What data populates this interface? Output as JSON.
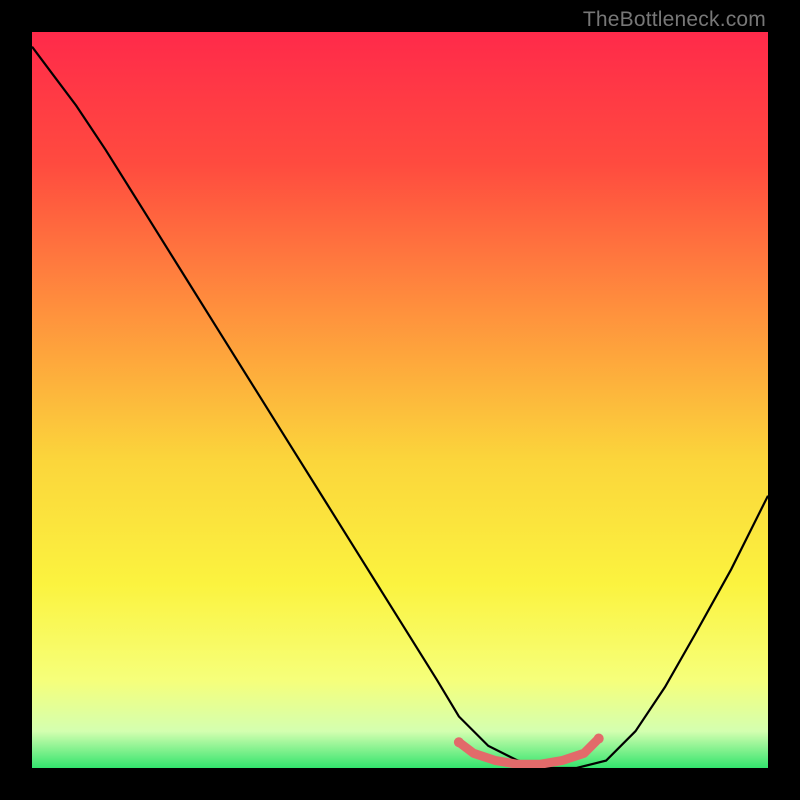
{
  "watermark": "TheBottleneck.com",
  "chart_data": {
    "type": "line",
    "title": "",
    "xlabel": "",
    "ylabel": "",
    "xlim": [
      0,
      1
    ],
    "ylim": [
      0,
      1
    ],
    "background_gradient": {
      "top": "#ff2a4a",
      "mid_upper": "#ff913d",
      "mid": "#fbe23b",
      "lower": "#f9ff8a",
      "bottom": "#33e46d"
    },
    "series": [
      {
        "name": "curve",
        "color": "#000000",
        "x": [
          0.0,
          0.03,
          0.06,
          0.1,
          0.15,
          0.2,
          0.25,
          0.3,
          0.35,
          0.4,
          0.45,
          0.5,
          0.55,
          0.58,
          0.62,
          0.66,
          0.7,
          0.74,
          0.78,
          0.82,
          0.86,
          0.9,
          0.95,
          1.0
        ],
        "y": [
          0.98,
          0.94,
          0.9,
          0.84,
          0.76,
          0.68,
          0.6,
          0.52,
          0.44,
          0.36,
          0.28,
          0.2,
          0.12,
          0.07,
          0.03,
          0.01,
          0.0,
          0.0,
          0.01,
          0.05,
          0.11,
          0.18,
          0.27,
          0.37
        ]
      },
      {
        "name": "highlight",
        "color": "#e26a6a",
        "x": [
          0.58,
          0.6,
          0.63,
          0.66,
          0.69,
          0.72,
          0.75,
          0.77
        ],
        "y": [
          0.035,
          0.02,
          0.01,
          0.005,
          0.005,
          0.01,
          0.02,
          0.04
        ]
      }
    ]
  }
}
